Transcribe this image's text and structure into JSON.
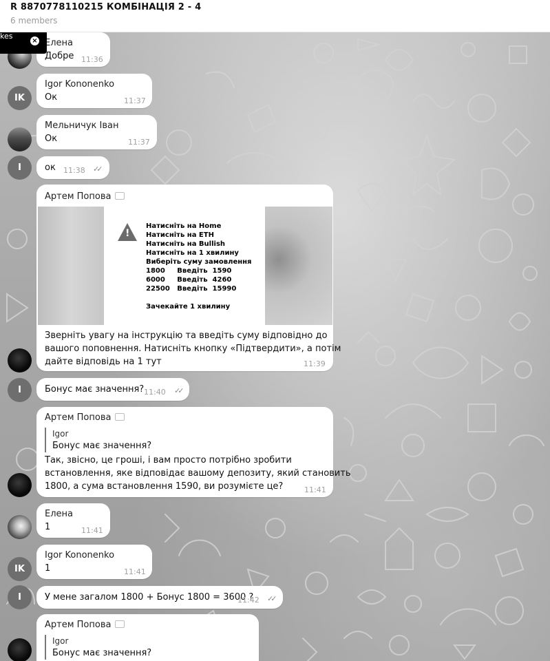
{
  "header": {
    "title": "R 8870778110215 КОМБІНАЦІЯ 2 - 4",
    "subtitle": "6 members"
  },
  "toast": {
    "text": "kes",
    "close_glyph": "×"
  },
  "messages": [
    {
      "sender": "Елена",
      "text": "Добре",
      "time": "11:36"
    },
    {
      "avatar_initials": "IK",
      "sender": "Igor Kononenko",
      "text": "Ок",
      "time": "11:37"
    },
    {
      "sender": "Мельничук Іван",
      "text": "Ок",
      "time": "11:37"
    },
    {
      "avatar_initials": "I",
      "text": "ок",
      "time": "11:38",
      "ticks": "✓✓"
    },
    {
      "sender": "Артем Попова",
      "image_text": "Натисніть на Home\nНатисніть на ETH\nНатисніть на Bullish\nНатисніть на 1 хвилину\nВиберіть суму замовлення\n1800     Введіть  1590\n6000     Введіть  4260\n22500   Введіть  15990\n\nЗачекайте 1 хвилину",
      "lines": [
        "Зверніть увагу на інструкцію та введіть суму відповідно до",
        "вашого поповнення. Натисніть кнопку «Підтвердити», а потім",
        "дайте відповідь на 1 тут"
      ],
      "time": "11:39"
    },
    {
      "avatar_initials": "I",
      "text": "Бонус має значення?",
      "time": "11:40",
      "ticks": "✓✓"
    },
    {
      "sender": "Артем Попова",
      "quote_name": "Igor",
      "quote_text": "Бонус має значення?",
      "lines": [
        "Так, звісно, це гроші, і вам просто потрібно зробити",
        "встановлення, яке відповідає вашому депозиту, який становить",
        "1800, а сума встановлення 1590, ви розумієте це?"
      ],
      "time": "11:41"
    },
    {
      "sender": "Елена",
      "text": "1",
      "time": "11:41"
    },
    {
      "avatar_initials": "IK",
      "sender": "Igor Kononenko",
      "text": "1",
      "time": "11:41"
    },
    {
      "avatar_initials": "I",
      "text": "У мене загалом 1800 + Бонус 1800 = 3600 ?",
      "time": "11:42",
      "ticks": "✓✓"
    },
    {
      "sender": "Артем Попова",
      "quote_name": "Igor",
      "quote_text": "Бонус має значення?"
    }
  ]
}
